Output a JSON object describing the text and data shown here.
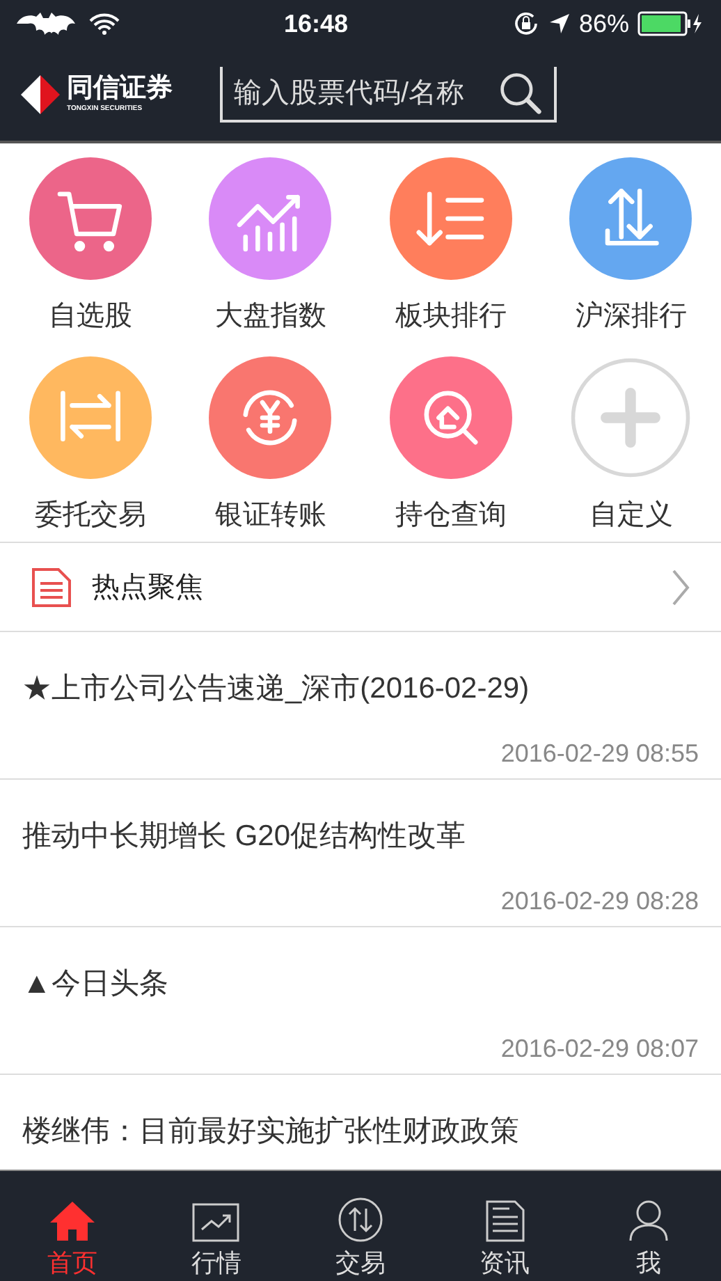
{
  "status_bar": {
    "time": "16:48",
    "battery": "86%"
  },
  "header": {
    "logo_name": "同信证券",
    "logo_subtitle": "TONGXIN SECURITIES",
    "search": {
      "placeholder": "输入股票代码/名称"
    }
  },
  "shortcuts": [
    {
      "label": "自选股",
      "kind": "shortcut",
      "color": "#ec6589"
    },
    {
      "label": "大盘指数",
      "kind": "shortcut",
      "color": "#d98af7"
    },
    {
      "label": "板块排行",
      "kind": "shortcut",
      "color": "#ff7e5c"
    },
    {
      "label": "沪深排行",
      "kind": "shortcut",
      "color": "#64a7f0"
    },
    {
      "label": "委托交易",
      "kind": "shortcut",
      "color": "#ffb85f"
    },
    {
      "label": "银证转账",
      "kind": "shortcut",
      "color": "#f9766f"
    },
    {
      "label": "持仓查询",
      "kind": "shortcut",
      "color": "#fd7089"
    },
    {
      "label": "自定义",
      "kind": "add",
      "color": "#d8d8d8"
    }
  ],
  "hot_section": {
    "title": "热点聚焦"
  },
  "news": [
    {
      "title": "★上市公司公告速递_深市(2016-02-29)",
      "time": "2016-02-29 08:55"
    },
    {
      "title": "推动中长期增长 G20促结构性改革",
      "time": "2016-02-29 08:28"
    },
    {
      "title": "▲今日头条",
      "time": "2016-02-29 08:07"
    },
    {
      "title": "楼继伟：目前最好实施扩张性财政政策"
    }
  ],
  "tab_bar": [
    {
      "label": "首页",
      "selected": true
    },
    {
      "label": "行情",
      "selected": false
    },
    {
      "label": "交易",
      "selected": false
    },
    {
      "label": "资讯",
      "selected": false
    },
    {
      "label": "我",
      "selected": false
    }
  ]
}
